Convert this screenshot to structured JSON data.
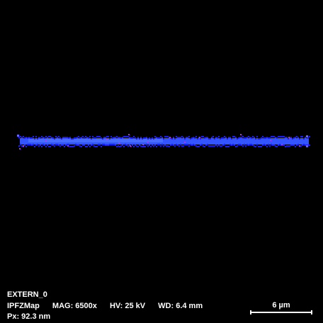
{
  "image": {
    "background": "#000000",
    "band_color_core": "#3355ff",
    "band_color_edge": "#1a1aff",
    "band_color_speck": "#aa33ff"
  },
  "info": {
    "title": "EXTERN_0",
    "map_type": "IPFZMap",
    "mag": "MAG: 6500x",
    "hv": "HV: 25 kV",
    "wd": "WD: 6.4 mm",
    "pixel_size": "Px: 92.3 nm"
  },
  "scale_bar": {
    "label": "6 µm"
  }
}
